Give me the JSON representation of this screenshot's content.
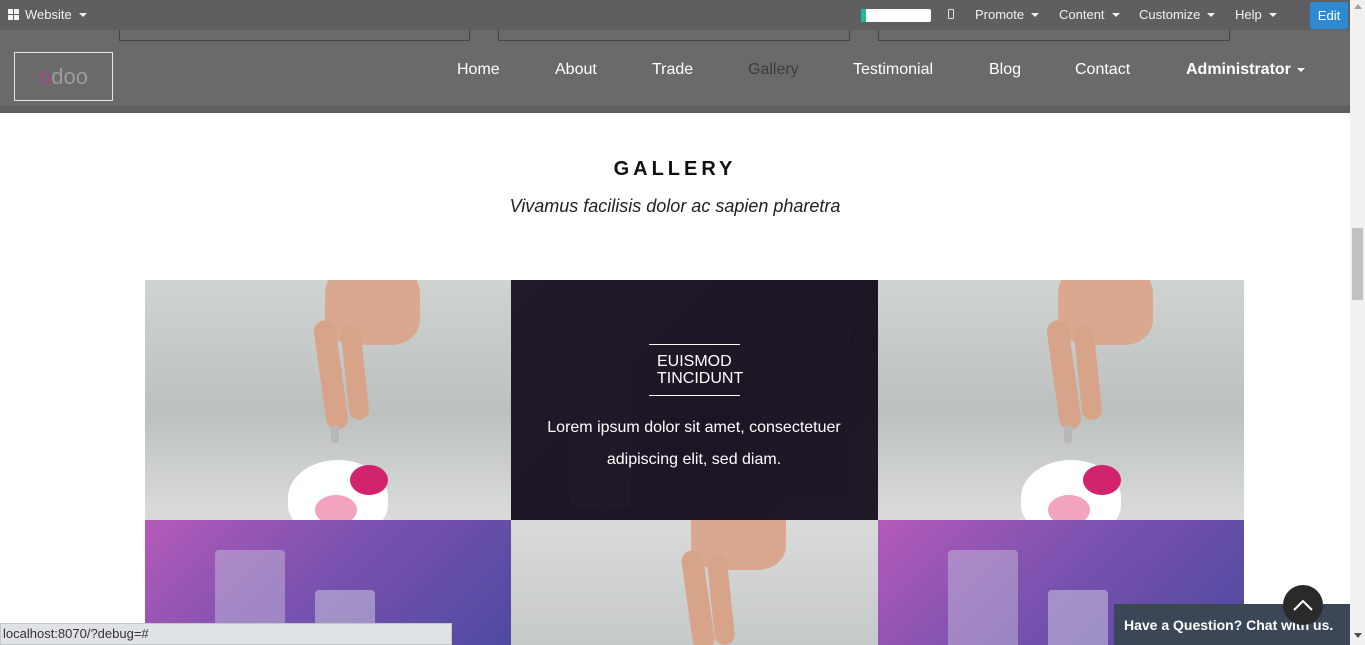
{
  "admin_bar": {
    "website_label": "Website",
    "progress_fraction": 0.07,
    "menus": [
      "Promote",
      "Content",
      "Customize",
      "Help"
    ],
    "edit_label": "Edit"
  },
  "header": {
    "logo_text_a": "o",
    "logo_text_b": "doo",
    "nav": [
      "Home",
      "About",
      "Trade",
      "Gallery",
      "Testimonial",
      "Blog",
      "Contact"
    ],
    "active_nav": "Gallery",
    "user_label": "Administrator"
  },
  "gallery": {
    "title": "GALLERY",
    "subtitle": "Vivamus facilisis dolor ac sapien pharetra",
    "card_title_line1": "EUISMOD",
    "card_title_line2": "TINCIDUNT",
    "card_text": "Lorem ipsum dolor sit amet, consectetuer adipiscing elit, sed diam."
  },
  "status_bar": {
    "url": "localhost:8070/?debug=#"
  },
  "chat": {
    "label": "Have a Question? Chat with us."
  },
  "colors": {
    "admin_bar": "#5f5f5f",
    "header": "#6a6a6a",
    "edit_button": "#2d8ad2",
    "chat_bar": "#3b4756",
    "progress_fill": "#21b799"
  }
}
